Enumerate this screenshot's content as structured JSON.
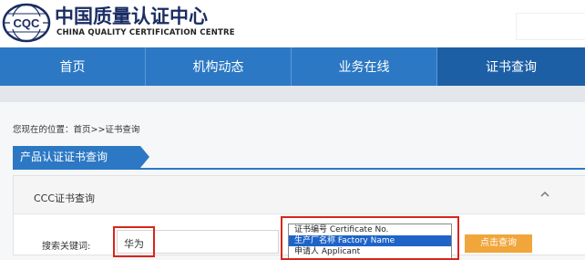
{
  "header": {
    "logo_text": "CQC",
    "title_cn": "中国质量认证中心",
    "title_en": "CHINA QUALITY CERTIFICATION CENTRE"
  },
  "nav": {
    "items": [
      {
        "label": "首页"
      },
      {
        "label": "机构动态"
      },
      {
        "label": "业务在线"
      },
      {
        "label": "证书查询",
        "active": true
      }
    ]
  },
  "breadcrumb": "您现在的位置：首页>>证书查询",
  "section": {
    "title": "产品认证证书查询"
  },
  "panel": {
    "title": "CCC证书查询",
    "keyword_label": "搜索关键词:",
    "keyword_value": "华为",
    "search_type_options": [
      "证书编号 Certificate No.",
      "生产厂名称 Factory Name",
      "申请人 Applicant"
    ],
    "selected_option": "生产厂名称 Factory Name",
    "query_button": "点击查询"
  },
  "colors": {
    "brand_blue": "#2c78c4",
    "highlight_red": "#d8261c",
    "button_orange": "#f0a63a"
  }
}
